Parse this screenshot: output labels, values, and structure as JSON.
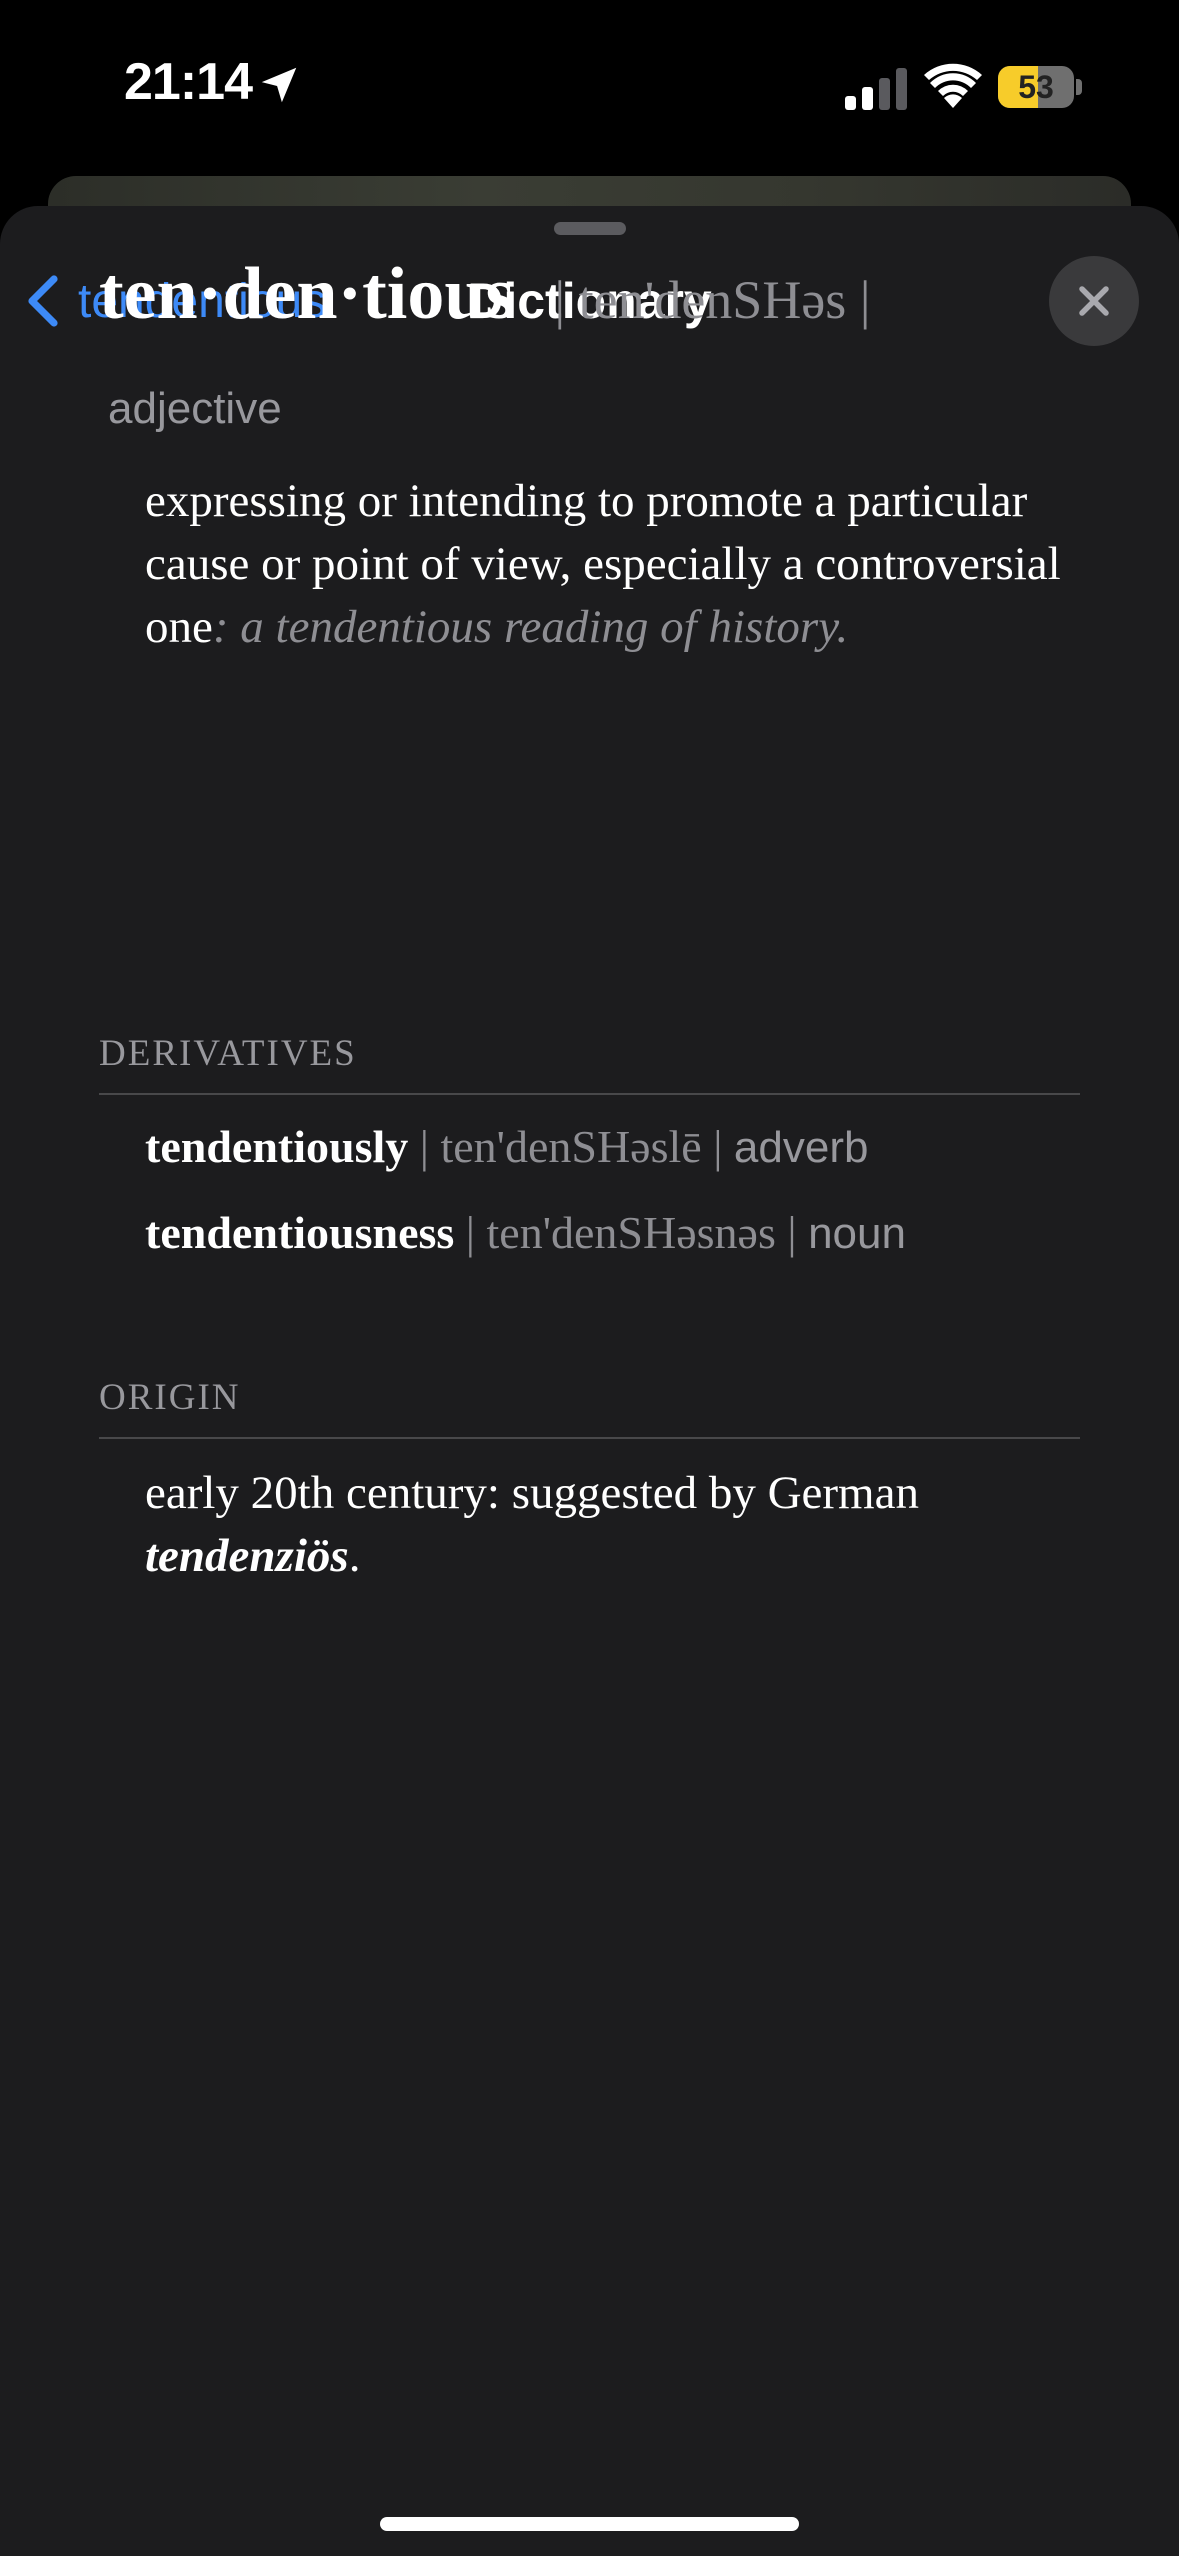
{
  "status_bar": {
    "time": "21:14",
    "battery_level": "53",
    "battery_fraction": 0.53,
    "icons": [
      "location-arrow-icon",
      "signal-icon",
      "wifi-icon",
      "battery-icon"
    ]
  },
  "nav": {
    "back_label": "tendentious",
    "title": "Dictionary",
    "back_icon": "chevron-left-icon",
    "close_icon": "close-icon"
  },
  "entry": {
    "headword": "ten·den·tious",
    "pronunciation": "| ten'denSHəs |",
    "part_of_speech": "adjective",
    "definition": "expressing or intending to promote a particular cause or point of view, especially a controversial one",
    "definition_sep": ": ",
    "example": "a tendentious reading of history."
  },
  "derivatives": {
    "heading": "DERIVATIVES",
    "items": [
      {
        "word": "tendentiously",
        "pronunciation": " | ten'denSHəslē | ",
        "pos": "adverb"
      },
      {
        "word": "tendentiousness",
        "pronunciation": " | ten'denSHəsnəs | ",
        "pos": "noun"
      }
    ]
  },
  "origin": {
    "heading": "ORIGIN",
    "text": "early 20th century: suggested by German ",
    "word": "tendenziös",
    "end": "."
  },
  "colors": {
    "sheet_background": "#1c1c1e",
    "accent": "#3d8af7",
    "secondary_text": "#8e8e93",
    "battery_fill": "#f7cc2a"
  }
}
